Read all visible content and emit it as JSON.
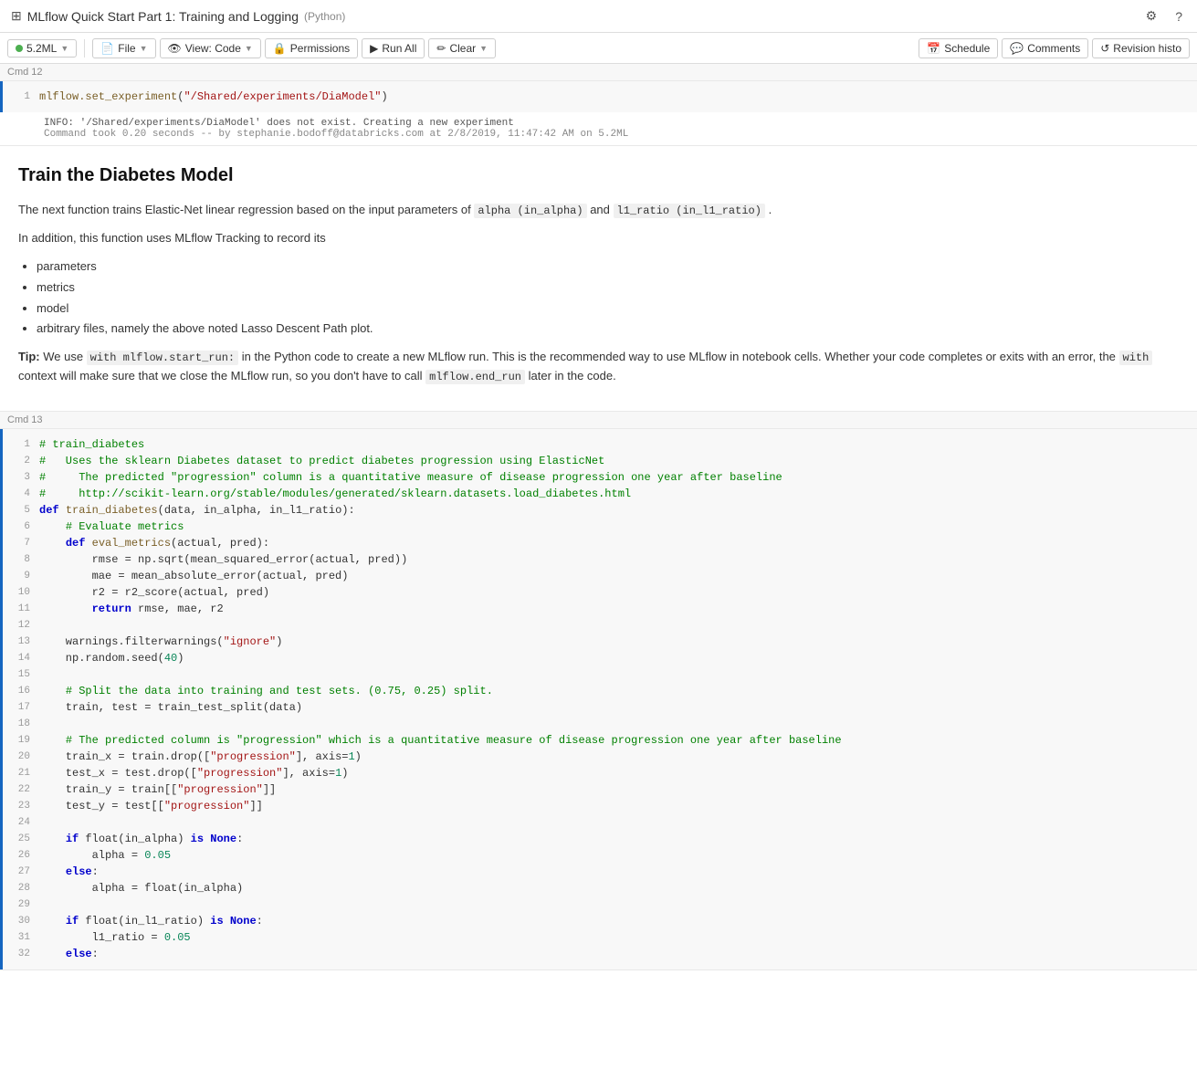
{
  "header": {
    "title": "MLflow Quick Start Part 1: Training and Logging",
    "subtitle": "(Python)",
    "icons": {
      "settings": "⚙",
      "help": "?"
    }
  },
  "toolbar": {
    "cluster_name": "5.2ML",
    "cluster_dot_color": "#4caf50",
    "file_label": "File",
    "view_label": "View: Code",
    "permissions_label": "Permissions",
    "run_all_label": "Run All",
    "clear_label": "Clear",
    "schedule_label": "Schedule",
    "comments_label": "Comments",
    "revision_label": "Revision histo"
  },
  "cells": {
    "cmd12_label": "Cmd 12",
    "cmd13_label": "Cmd 13",
    "cmd12_code": "mlflow.set_experiment(\"/Shared/experiments/DiaModel\")",
    "cmd12_output_info": "INFO: '/Shared/experiments/DiaModel' does not exist. Creating a new experiment",
    "cmd12_output_meta": "Command took 0.20 seconds -- by stephanie.bodoff@databricks.com at 2/8/2019, 11:47:42 AM on 5.2ML",
    "markdown_heading": "Train the Diabetes Model",
    "markdown_p1_before": "The next function trains Elastic-Net linear regression based on the input parameters of",
    "markdown_p1_code1": "alpha (in_alpha)",
    "markdown_p1_mid": "and",
    "markdown_p1_code2": "l1_ratio (in_l1_ratio)",
    "markdown_p2": "In addition, this function uses MLflow Tracking to record its",
    "markdown_bullets": [
      "parameters",
      "metrics",
      "model",
      "arbitrary files, namely the above noted Lasso Descent Path plot."
    ],
    "markdown_tip_label": "Tip:",
    "markdown_tip_before": "We use",
    "markdown_tip_code1": "with mlflow.start_run:",
    "markdown_tip_mid": "in the Python code to create a new MLflow run. This is the recommended way to use MLflow in notebook cells. Whether your code completes or exits with an error, the",
    "markdown_tip_code2": "with",
    "markdown_tip_after": "context will make sure that we close the MLflow run, so you don't have to call",
    "markdown_tip_code3": "mlflow.end_run",
    "markdown_tip_end": "later in the code."
  }
}
